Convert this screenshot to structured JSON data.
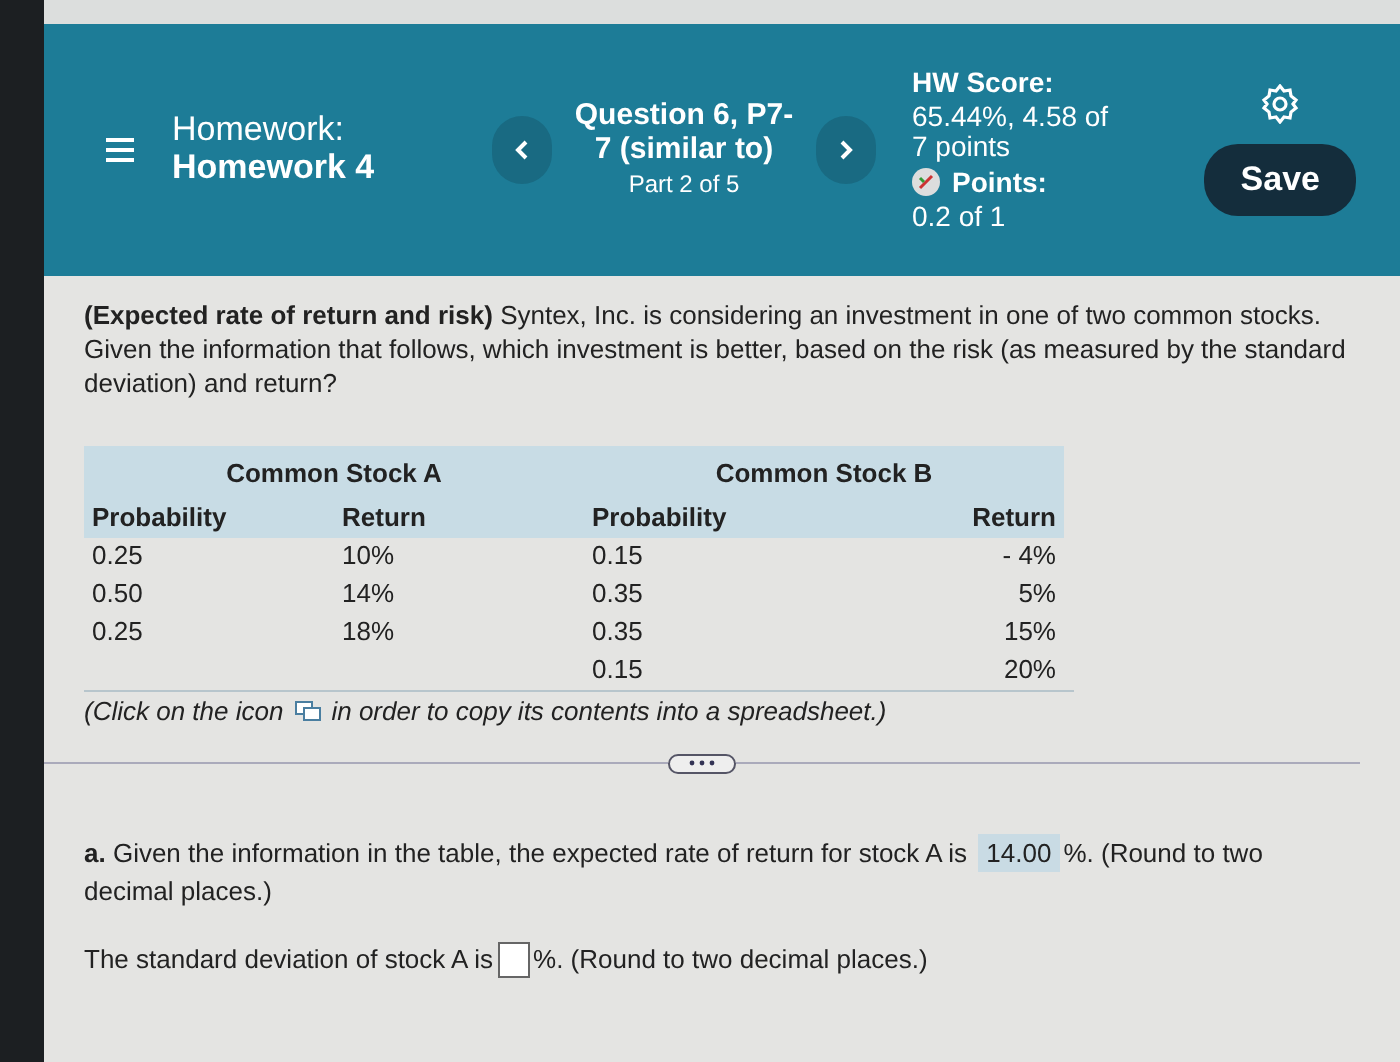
{
  "header": {
    "menu_label": "Homework:",
    "homework": "Homework 4",
    "question": "Question 6, P7-7 (similar to)",
    "part": "Part 2 of 5",
    "score_label": "HW Score:",
    "score": "65.44%, 4.58 of 7 points",
    "points_label": "Points:",
    "points": "0.2 of 1",
    "save": "Save"
  },
  "intro": "**(Expected rate of return and risk)** Syntex, Inc. is considering an investment in one of two common stocks.  Given the information that follows, which investment is better, based on the risk (as measured by the standard deviation) and return?",
  "table": {
    "groups": [
      {
        "title": "Common Stock A",
        "columns": [
          "Probability",
          "Return"
        ],
        "rows": [
          [
            "0.25",
            "10%"
          ],
          [
            "0.50",
            "14%"
          ],
          [
            "0.25",
            "18%"
          ]
        ]
      },
      {
        "title": "Common Stock B",
        "columns": [
          "Probability",
          "Return"
        ],
        "rows": [
          [
            "0.15",
            "- 4%"
          ],
          [
            "0.35",
            "5%"
          ],
          [
            "0.35",
            "15%"
          ],
          [
            "0.15",
            "20%"
          ]
        ]
      }
    ]
  },
  "copy_note_before": "(Click on the icon",
  "copy_note_after": "in order to copy its contents into a spreadsheet.)",
  "question_a": {
    "before": "**a.** Given the information in the table, the expected rate of return for stock A is",
    "answer": "14.00",
    "after": "%. (Round to two",
    "after_wrapped": "decimal places.)"
  },
  "question_b": {
    "before": "The standard deviation of stock A is",
    "after": "%. (Round to two decimal places.)"
  }
}
